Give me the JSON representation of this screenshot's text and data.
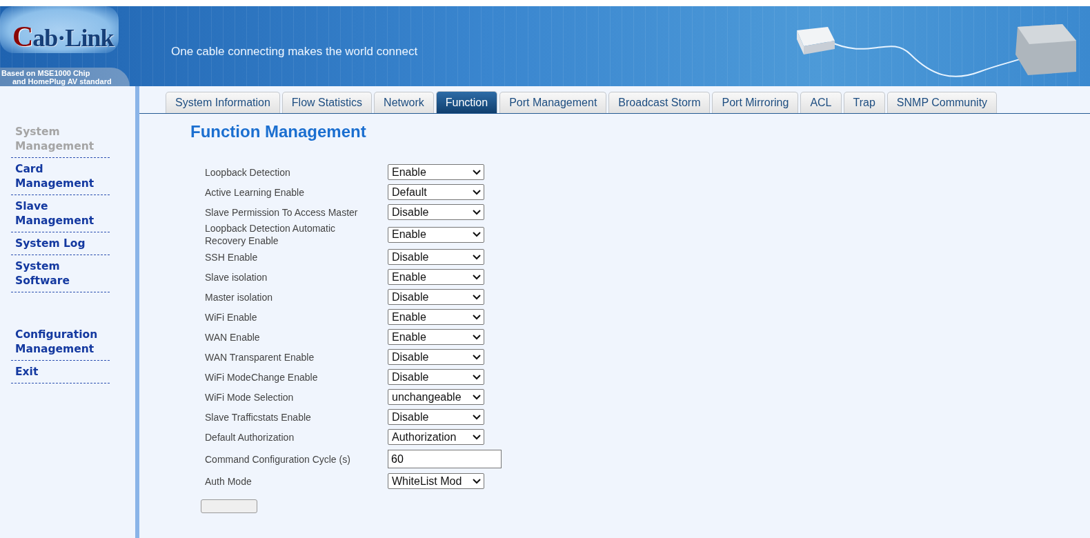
{
  "banner": {
    "logo": {
      "initial": "C",
      "rest": "ab·Link"
    },
    "slogan": "One cable connecting makes the world connect",
    "chip_note": [
      "Based on MSE1000 Chip",
      "and HomePlug AV standard"
    ]
  },
  "sidebar": {
    "groups": [
      {
        "items": [
          {
            "label": "System Management",
            "selected": true
          },
          {
            "label": "Card Management",
            "selected": false
          },
          {
            "label": "Slave Management",
            "selected": false
          },
          {
            "label": "System Log",
            "selected": false
          },
          {
            "label": "System Software",
            "selected": false
          }
        ]
      },
      {
        "items": [
          {
            "label": "Configuration Management",
            "selected": false
          },
          {
            "label": "Exit",
            "selected": false
          }
        ]
      }
    ]
  },
  "tabs": [
    {
      "label": "System Information",
      "selected": false
    },
    {
      "label": "Flow Statistics",
      "selected": false
    },
    {
      "label": "Network",
      "selected": false
    },
    {
      "label": "Function",
      "selected": true
    },
    {
      "label": "Port Management",
      "selected": false
    },
    {
      "label": "Broadcast Storm",
      "selected": false
    },
    {
      "label": "Port Mirroring",
      "selected": false
    },
    {
      "label": "ACL",
      "selected": false
    },
    {
      "label": "Trap",
      "selected": false
    },
    {
      "label": "SNMP Community",
      "selected": false
    }
  ],
  "page_title": "Function Management",
  "settings": [
    {
      "label": "Loopback Detection",
      "kind": "select",
      "value": "Enable"
    },
    {
      "label": "Active Learning Enable",
      "kind": "select",
      "value": "Default"
    },
    {
      "label": "Slave Permission To Access Master",
      "kind": "select",
      "value": "Disable"
    },
    {
      "label": "Loopback Detection Automatic Recovery Enable",
      "kind": "select",
      "value": "Enable"
    },
    {
      "label": "SSH Enable",
      "kind": "select",
      "value": "Disable"
    },
    {
      "label": "Slave isolation",
      "kind": "select",
      "value": "Enable"
    },
    {
      "label": "Master isolation",
      "kind": "select",
      "value": "Disable"
    },
    {
      "label": "WiFi Enable",
      "kind": "select",
      "value": "Enable"
    },
    {
      "label": "WAN Enable",
      "kind": "select",
      "value": "Enable"
    },
    {
      "label": "WAN Transparent Enable",
      "kind": "select",
      "value": "Disable"
    },
    {
      "label": "WiFi ModeChange Enable",
      "kind": "select",
      "value": "Disable"
    },
    {
      "label": "WiFi Mode Selection",
      "kind": "select",
      "value": "unchangeable"
    },
    {
      "label": "Slave Trafficstats Enable",
      "kind": "select",
      "value": "Disable"
    },
    {
      "label": "Default Authorization",
      "kind": "select",
      "value": "Authorization"
    },
    {
      "label": "Command Configuration Cycle (s)",
      "kind": "text",
      "value": "60"
    },
    {
      "label": "Auth Mode",
      "kind": "select",
      "value": "WhiteList Mod"
    }
  ]
}
